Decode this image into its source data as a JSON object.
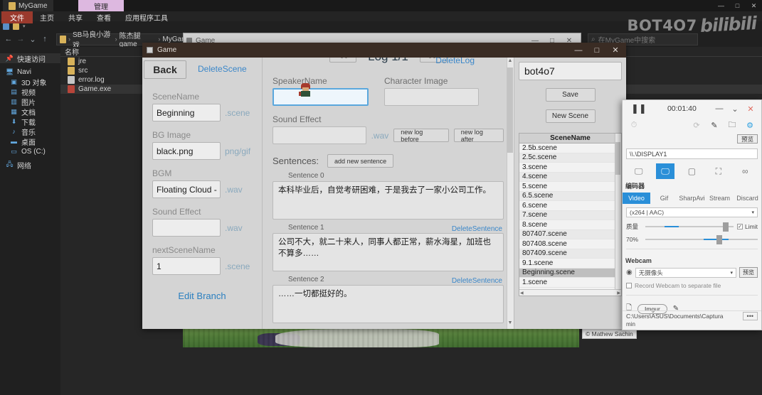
{
  "explorer": {
    "tab_title": "MyGame",
    "manage_tab": "管理",
    "ribbon": [
      "文件",
      "主页",
      "共享",
      "查看",
      "应用程序工具"
    ],
    "breadcrumb": [
      "SB马良小游戏",
      "陈杰腿 game",
      "MyGame"
    ],
    "search_placeholder": "在MyGame中搜索",
    "nav": {
      "back": "←",
      "forward": "→",
      "recent": "⌄",
      "up": "↑"
    },
    "window_buttons": [
      "—",
      "□",
      "✕"
    ],
    "sidebar": [
      {
        "label": "快速访问",
        "icon": "pin-icon",
        "selected": true
      },
      {
        "label": "Navi",
        "icon": "computer-icon",
        "selected": false
      },
      {
        "label": "3D 对象",
        "icon": "cube-icon",
        "selected": false
      },
      {
        "label": "视频",
        "icon": "video-icon",
        "selected": false
      },
      {
        "label": "图片",
        "icon": "pictures-icon",
        "selected": false
      },
      {
        "label": "文档",
        "icon": "documents-icon",
        "selected": false
      },
      {
        "label": "下载",
        "icon": "download-icon",
        "selected": false
      },
      {
        "label": "音乐",
        "icon": "music-icon",
        "selected": false
      },
      {
        "label": "桌面",
        "icon": "desktop-icon",
        "selected": false
      },
      {
        "label": "OS (C:)",
        "icon": "drive-icon",
        "selected": false
      },
      {
        "label": "网络",
        "icon": "network-icon",
        "selected": false
      }
    ],
    "list_header": "名称",
    "files": [
      {
        "name": "jre",
        "kind": "folder",
        "selected": false
      },
      {
        "name": "src",
        "kind": "folder",
        "selected": false
      },
      {
        "name": "error.log",
        "kind": "log",
        "selected": false
      },
      {
        "name": "Game.exe",
        "kind": "exe",
        "selected": true
      }
    ]
  },
  "watermark": {
    "text": "BOT4O7",
    "brand": "bilibili"
  },
  "game_window_back": {
    "title": "Game",
    "buttons": [
      "—",
      "□",
      "✕"
    ]
  },
  "game_window": {
    "title": "Game",
    "buttons": [
      "—",
      "□",
      "✕"
    ],
    "left": {
      "back_label": "Back",
      "delete_scene_label": "DeleteScene",
      "fields": [
        {
          "label": "SceneName",
          "value": "Beginning",
          "suffix": ".scene"
        },
        {
          "label": "BG Image",
          "value": "black.png",
          "suffix": "png/gif"
        },
        {
          "label": "BGM",
          "value": "Floating Cloud - 彡",
          "suffix": ".wav"
        },
        {
          "label": "Sound Effect",
          "value": "",
          "suffix": ".wav"
        },
        {
          "label": "nextSceneName",
          "value": "1",
          "suffix": ".scene"
        }
      ],
      "edit_branch_label": "Edit Branch"
    },
    "center": {
      "prev_label": "<<",
      "next_label": ">>",
      "log_title": "Log 1/1",
      "delete_log_label": "DeleteLog",
      "speaker_label": "SpeakerName",
      "speaker_value": "",
      "character_image_label": "Character Image",
      "character_image_value": "",
      "sound_effect_label": "Sound Effect",
      "sound_effect_value": "",
      "sound_effect_suffix": ".wav",
      "new_log_before_label": "new log before",
      "new_log_after_label": "new log after",
      "sentences_title": "Sentences:",
      "add_sentence_label": "add new sentence",
      "delete_sentence_label": "DeleteSentence",
      "sentences": [
        {
          "label": "Sentence 0",
          "text": "本科毕业后，自觉考研困难，于是我去了一家小公司工作。",
          "deletable": false
        },
        {
          "label": "Sentence 1",
          "text": "公司不大，就二十来人，同事人都正常，薪水海星，加班也不算多……",
          "deletable": true
        },
        {
          "label": "Sentence 2",
          "text": "……一切都挺好的。",
          "deletable": true
        }
      ]
    },
    "right": {
      "name_value": "bot4o7",
      "save_label": "Save",
      "new_scene_label": "New Scene",
      "table_header": "SceneName",
      "scenes": [
        {
          "name": "2.5b.scene",
          "selected": false
        },
        {
          "name": "2.5c.scene",
          "selected": false
        },
        {
          "name": "3.scene",
          "selected": false
        },
        {
          "name": "4.scene",
          "selected": false
        },
        {
          "name": "5.scene",
          "selected": false
        },
        {
          "name": "6.5.scene",
          "selected": false
        },
        {
          "name": "6.scene",
          "selected": false
        },
        {
          "name": "7.scene",
          "selected": false
        },
        {
          "name": "8.scene",
          "selected": false
        },
        {
          "name": "807407.scene",
          "selected": false
        },
        {
          "name": "807408.scene",
          "selected": false
        },
        {
          "name": "807409.scene",
          "selected": false
        },
        {
          "name": "9.1.scene",
          "selected": false
        },
        {
          "name": "Beginning.scene",
          "selected": true
        },
        {
          "name": "1.scene",
          "selected": false
        }
      ]
    }
  },
  "preview": {
    "credit": "© Mathew Sachin"
  },
  "captura": {
    "timer": "00:01:40",
    "pause_icon": "pause-icon",
    "window_buttons": [
      "—",
      "⌄",
      "✕"
    ],
    "preview_button": "预览",
    "display_value": "\\\\.\\DISPLAY1",
    "modes": [
      "screen-icon",
      "window-icon",
      "region-icon",
      "fullscreen-icon",
      "nocapture-icon"
    ],
    "active_mode_index": 1,
    "section_label": "编码器",
    "tabs": [
      "Video",
      "Gif",
      "SharpAvi",
      "Stream",
      "Discard"
    ],
    "active_tab_index": 0,
    "codec_value": "(x264 | AAC)",
    "quality_label": "质量",
    "quality_percent": "70%",
    "limit_label": "Limit",
    "webcam_title": "Webcam",
    "webcam_value": "无摄像头",
    "webcam_preview": "预览",
    "webcam_checkbox_label": "Record Webcam to separate file",
    "imgur_label": "Imgur",
    "output_path": "C:\\Users\\ASUS\\Documents\\Captura",
    "dots_label": "•••",
    "bottom_hint": "min"
  },
  "colors": {
    "accent_blue": "#2a8fd8",
    "link_blue": "#3b87c9",
    "title_brown": "#3a2c24",
    "file_red": "#9b3a2d",
    "manage_purple": "#ddb8e0"
  }
}
